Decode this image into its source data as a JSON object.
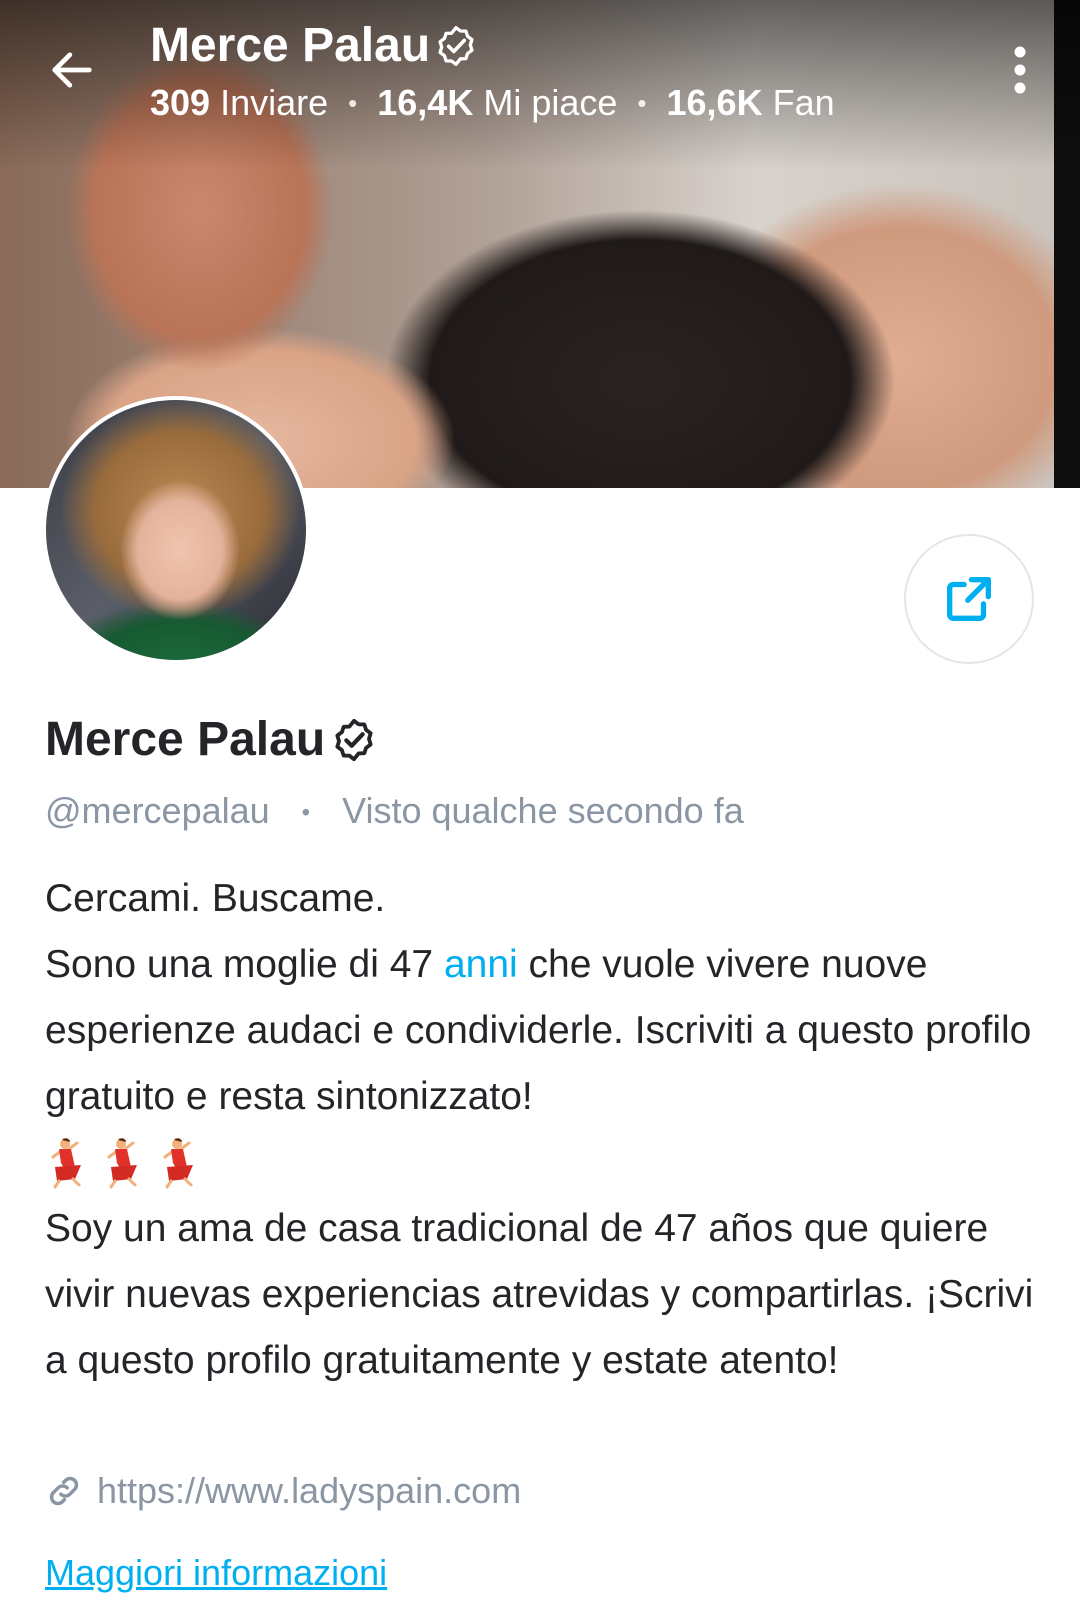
{
  "header": {
    "name": "Merce Palau",
    "stats": [
      {
        "value": "309",
        "label": "Inviare"
      },
      {
        "value": "16,4K",
        "label": "Mi piace"
      },
      {
        "value": "16,6K",
        "label": "Fan"
      }
    ]
  },
  "profile": {
    "name": "Merce Palau",
    "handle": "@mercepalau",
    "last_seen": "Visto qualche secondo fa"
  },
  "bio": {
    "line1": "Cercami. Buscame.",
    "line2_before": "Sono una moglie di 47 ",
    "line2_link": "anni",
    "line2_after": " che vuole vivere nuove esperienze audaci e condividerle. Iscriviti a questo profilo gratuito e resta sintonizzato!",
    "emoji_name": "dancer-emoji",
    "emoji_count": 3,
    "spanish": "Soy un ama de casa tradicional de 47 años que quiere vivir nuevas experiencias atrevidas y compartirlas. ¡Scrivi a questo profilo gratuitamente y estate atento!"
  },
  "website": "https://www.ladyspain.com",
  "more_info_label": "Maggiori informazioni",
  "icons": {
    "back": "arrow-left-icon",
    "verified": "verified-badge-icon",
    "more": "more-vertical-icon",
    "share": "share-icon",
    "link": "link-icon"
  },
  "colors": {
    "accent": "#00aff0",
    "text": "#242529",
    "muted": "#8a96a3"
  }
}
